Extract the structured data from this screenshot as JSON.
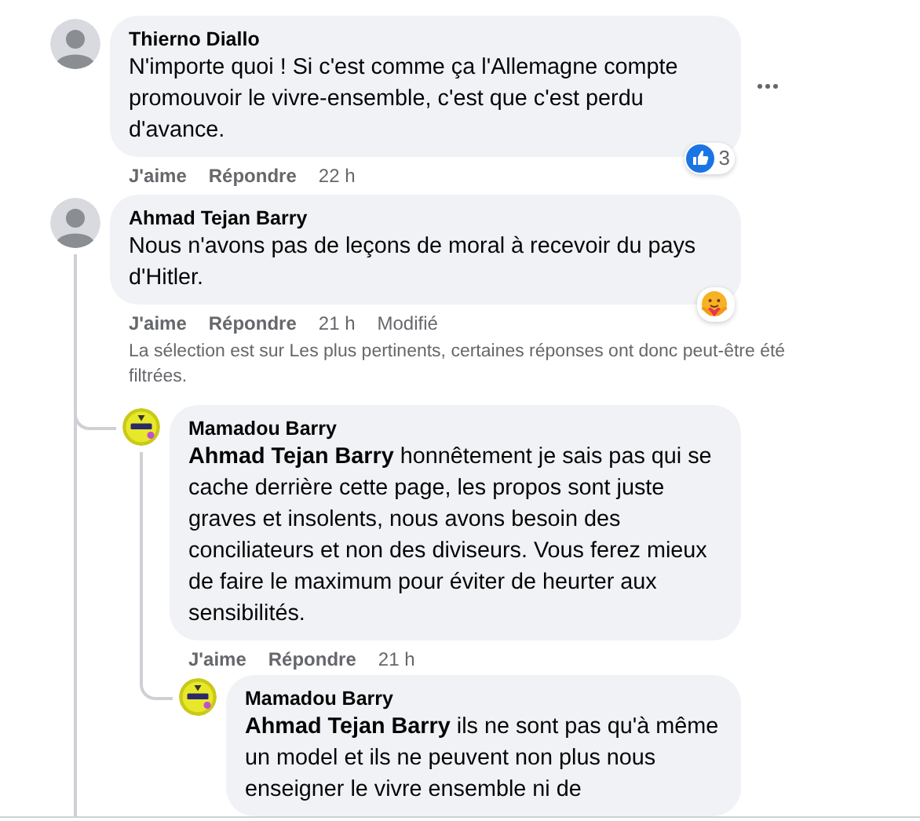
{
  "comments": [
    {
      "author": "Thierno Diallo",
      "avatar": {
        "kind": "person"
      },
      "text": "N'importe quoi ! Si c'est comme ça l'Allemagne compte promouvoir le vivre-ensemble, c'est que c'est perdu d'avance.",
      "more_button": true,
      "actions": [
        {
          "label": "J'aime"
        },
        {
          "label": "Répondre"
        }
      ],
      "time": "22 h",
      "reaction": {
        "kind": "like",
        "count": "3"
      }
    },
    {
      "author": "Ahmad Tejan Barry",
      "avatar": {
        "kind": "person"
      },
      "text": "Nous n'avons pas de leçons de moral à recevoir du pays d'Hitler.",
      "actions": [
        {
          "label": "J'aime"
        },
        {
          "label": "Répondre"
        }
      ],
      "time": "21 h",
      "edited": "Modifié",
      "reaction": {
        "kind": "care"
      },
      "notice": "La sélection est sur Les plus pertinents, certaines réponses ont donc peut-être été filtrées.",
      "replies": [
        {
          "author": "Mamadou Barry",
          "avatar": {
            "kind": "logo"
          },
          "text": "**Ahmad Tejan Barry** honnêtement je sais pas qui se cache derrière cette page, les propos sont juste graves et insolents, nous avons besoin des conciliateurs et non des diviseurs. Vous ferez mieux de faire le maximum pour éviter de heurter aux sensibilités.",
          "actions": [
            {
              "label": "J'aime"
            },
            {
              "label": "Répondre"
            }
          ],
          "time": "21 h",
          "replies": [
            {
              "author": "Mamadou Barry",
              "avatar": {
                "kind": "logo"
              },
              "text": "**Ahmad Tejan Barry** ils ne sont pas qu'à même un model et ils ne peuvent non plus nous enseigner le vivre ensemble ni de"
            }
          ]
        }
      ]
    }
  ]
}
